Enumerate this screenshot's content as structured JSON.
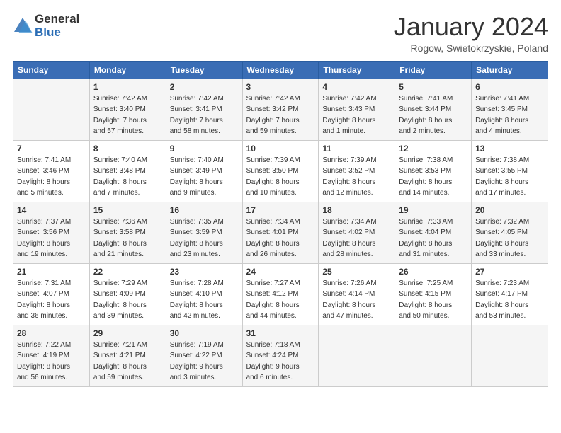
{
  "header": {
    "logo_general": "General",
    "logo_blue": "Blue",
    "month_title": "January 2024",
    "subtitle": "Rogow, Swietokrzyskie, Poland"
  },
  "days_of_week": [
    "Sunday",
    "Monday",
    "Tuesday",
    "Wednesday",
    "Thursday",
    "Friday",
    "Saturday"
  ],
  "weeks": [
    [
      {
        "day": "",
        "info": ""
      },
      {
        "day": "1",
        "info": "Sunrise: 7:42 AM\nSunset: 3:40 PM\nDaylight: 7 hours\nand 57 minutes."
      },
      {
        "day": "2",
        "info": "Sunrise: 7:42 AM\nSunset: 3:41 PM\nDaylight: 7 hours\nand 58 minutes."
      },
      {
        "day": "3",
        "info": "Sunrise: 7:42 AM\nSunset: 3:42 PM\nDaylight: 7 hours\nand 59 minutes."
      },
      {
        "day": "4",
        "info": "Sunrise: 7:42 AM\nSunset: 3:43 PM\nDaylight: 8 hours\nand 1 minute."
      },
      {
        "day": "5",
        "info": "Sunrise: 7:41 AM\nSunset: 3:44 PM\nDaylight: 8 hours\nand 2 minutes."
      },
      {
        "day": "6",
        "info": "Sunrise: 7:41 AM\nSunset: 3:45 PM\nDaylight: 8 hours\nand 4 minutes."
      }
    ],
    [
      {
        "day": "7",
        "info": "Sunrise: 7:41 AM\nSunset: 3:46 PM\nDaylight: 8 hours\nand 5 minutes."
      },
      {
        "day": "8",
        "info": "Sunrise: 7:40 AM\nSunset: 3:48 PM\nDaylight: 8 hours\nand 7 minutes."
      },
      {
        "day": "9",
        "info": "Sunrise: 7:40 AM\nSunset: 3:49 PM\nDaylight: 8 hours\nand 9 minutes."
      },
      {
        "day": "10",
        "info": "Sunrise: 7:39 AM\nSunset: 3:50 PM\nDaylight: 8 hours\nand 10 minutes."
      },
      {
        "day": "11",
        "info": "Sunrise: 7:39 AM\nSunset: 3:52 PM\nDaylight: 8 hours\nand 12 minutes."
      },
      {
        "day": "12",
        "info": "Sunrise: 7:38 AM\nSunset: 3:53 PM\nDaylight: 8 hours\nand 14 minutes."
      },
      {
        "day": "13",
        "info": "Sunrise: 7:38 AM\nSunset: 3:55 PM\nDaylight: 8 hours\nand 17 minutes."
      }
    ],
    [
      {
        "day": "14",
        "info": "Sunrise: 7:37 AM\nSunset: 3:56 PM\nDaylight: 8 hours\nand 19 minutes."
      },
      {
        "day": "15",
        "info": "Sunrise: 7:36 AM\nSunset: 3:58 PM\nDaylight: 8 hours\nand 21 minutes."
      },
      {
        "day": "16",
        "info": "Sunrise: 7:35 AM\nSunset: 3:59 PM\nDaylight: 8 hours\nand 23 minutes."
      },
      {
        "day": "17",
        "info": "Sunrise: 7:34 AM\nSunset: 4:01 PM\nDaylight: 8 hours\nand 26 minutes."
      },
      {
        "day": "18",
        "info": "Sunrise: 7:34 AM\nSunset: 4:02 PM\nDaylight: 8 hours\nand 28 minutes."
      },
      {
        "day": "19",
        "info": "Sunrise: 7:33 AM\nSunset: 4:04 PM\nDaylight: 8 hours\nand 31 minutes."
      },
      {
        "day": "20",
        "info": "Sunrise: 7:32 AM\nSunset: 4:05 PM\nDaylight: 8 hours\nand 33 minutes."
      }
    ],
    [
      {
        "day": "21",
        "info": "Sunrise: 7:31 AM\nSunset: 4:07 PM\nDaylight: 8 hours\nand 36 minutes."
      },
      {
        "day": "22",
        "info": "Sunrise: 7:29 AM\nSunset: 4:09 PM\nDaylight: 8 hours\nand 39 minutes."
      },
      {
        "day": "23",
        "info": "Sunrise: 7:28 AM\nSunset: 4:10 PM\nDaylight: 8 hours\nand 42 minutes."
      },
      {
        "day": "24",
        "info": "Sunrise: 7:27 AM\nSunset: 4:12 PM\nDaylight: 8 hours\nand 44 minutes."
      },
      {
        "day": "25",
        "info": "Sunrise: 7:26 AM\nSunset: 4:14 PM\nDaylight: 8 hours\nand 47 minutes."
      },
      {
        "day": "26",
        "info": "Sunrise: 7:25 AM\nSunset: 4:15 PM\nDaylight: 8 hours\nand 50 minutes."
      },
      {
        "day": "27",
        "info": "Sunrise: 7:23 AM\nSunset: 4:17 PM\nDaylight: 8 hours\nand 53 minutes."
      }
    ],
    [
      {
        "day": "28",
        "info": "Sunrise: 7:22 AM\nSunset: 4:19 PM\nDaylight: 8 hours\nand 56 minutes."
      },
      {
        "day": "29",
        "info": "Sunrise: 7:21 AM\nSunset: 4:21 PM\nDaylight: 8 hours\nand 59 minutes."
      },
      {
        "day": "30",
        "info": "Sunrise: 7:19 AM\nSunset: 4:22 PM\nDaylight: 9 hours\nand 3 minutes."
      },
      {
        "day": "31",
        "info": "Sunrise: 7:18 AM\nSunset: 4:24 PM\nDaylight: 9 hours\nand 6 minutes."
      },
      {
        "day": "",
        "info": ""
      },
      {
        "day": "",
        "info": ""
      },
      {
        "day": "",
        "info": ""
      }
    ]
  ]
}
